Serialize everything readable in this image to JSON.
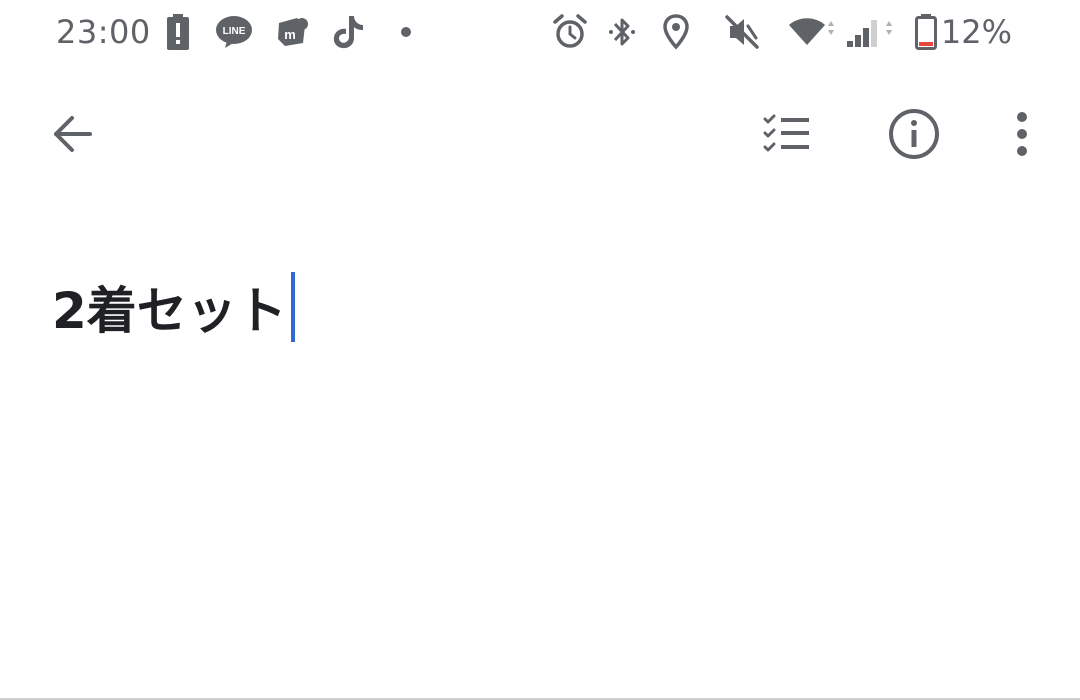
{
  "status_bar": {
    "time": "23:00",
    "battery_percent": "12%",
    "icons": [
      "battery-alert-icon",
      "line-app-icon",
      "mercari-app-icon",
      "tiktok-app-icon",
      "notification-dot-icon",
      "alarm-icon",
      "bluetooth-icon",
      "location-icon",
      "vibrate-off-icon",
      "wifi-icon",
      "cellular-signal-icon",
      "battery-icon"
    ],
    "battery_level_fraction": 0.12,
    "icon_color": "#5f6368",
    "battery_low_color": "#e8453c"
  },
  "toolbar": {
    "icons": [
      "back-arrow-icon",
      "checklist-icon",
      "info-icon",
      "more-vert-icon"
    ],
    "icon_color": "#5f6368"
  },
  "note": {
    "title": "2着セット",
    "text_color": "#202124",
    "caret_color": "#3367d6"
  }
}
